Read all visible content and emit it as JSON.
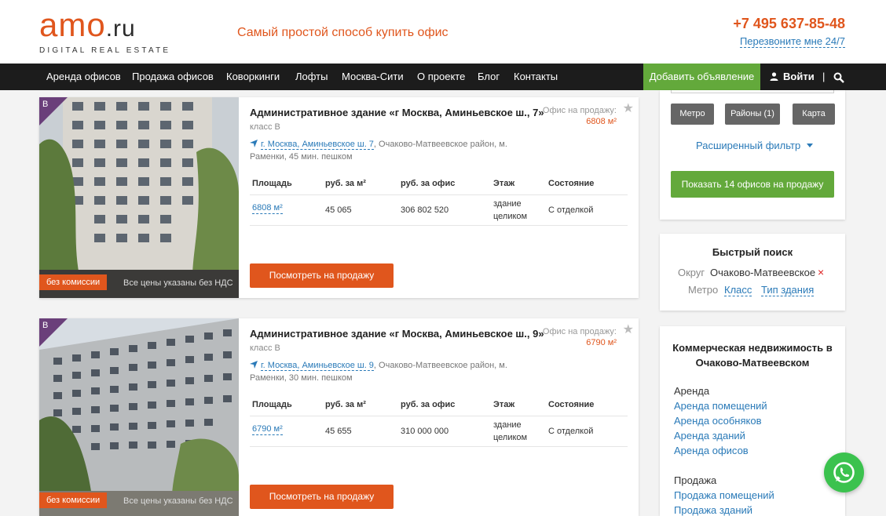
{
  "header": {
    "logo_main": "amo",
    "logo_tld": ".ru",
    "logo_sub": "DIGITAL REAL ESTATE",
    "slogan": "Самый простой способ купить офис",
    "phone": "+7 495 637-85-48",
    "callback": "Перезвоните мне 24/7"
  },
  "nav": {
    "items": [
      "Аренда офисов",
      "Продажа офисов",
      "Коворкинги",
      "Лофты",
      "Москва-Сити",
      "О проекте",
      "Блог",
      "Контакты"
    ],
    "add_listing": "Добавить объявление",
    "login": "Войти",
    "separator": "|"
  },
  "listings": [
    {
      "class_letter": "B",
      "badge": "без комиссии",
      "vat_note": "Все цены указаны без НДС",
      "title": "Административное здание «г Москва, Аминьевское ш., 7»",
      "class_label": "класс B",
      "address_link": "г. Москва, Аминьевское ш. 7",
      "address_rest": ", Очаково-Матвеевское район, м. Раменки, 45 мин. пешком",
      "sale_label": "Офис на продажу:",
      "sale_value": "6808 м²",
      "headers": [
        "Площадь",
        "руб. за м²",
        "руб. за офис",
        "Этаж",
        "Состояние"
      ],
      "row": [
        "6808 м²",
        "45 065",
        "306 802 520",
        "здание целиком",
        "С отделкой"
      ],
      "button": "Посмотреть на продажу"
    },
    {
      "class_letter": "B",
      "badge": "без комиссии",
      "vat_note": "Все цены указаны без НДС",
      "title": "Административное здание «г Москва, Аминьевское ш., 9»",
      "class_label": "класс B",
      "address_link": "г. Москва, Аминьевское ш. 9",
      "address_rest": ", Очаково-Матвеевское район, м. Раменки, 30 мин. пешком",
      "sale_label": "Офис на продажу:",
      "sale_value": "6790 м²",
      "headers": [
        "Площадь",
        "руб. за м²",
        "руб. за офис",
        "Этаж",
        "Состояние"
      ],
      "row": [
        "6790 м²",
        "45 655",
        "310 000 000",
        "здание целиком",
        "С отделкой"
      ],
      "button": "Посмотреть на продажу"
    }
  ],
  "filter": {
    "buttons": [
      "Метро",
      "Районы (1)",
      "Карта"
    ],
    "extended": "Расширенный фильтр",
    "show_button": "Показать 14 офисов на продажу"
  },
  "quick_search": {
    "title": "Быстрый поиск",
    "district_label": "Округ",
    "district_value": "Очаково-Матвеевское",
    "remove": "×",
    "metro_label": "Метро",
    "class_link": "Класс",
    "building_type_link": "Тип здания"
  },
  "commercial": {
    "title": "Коммерческая недвижимость в Очаково-Матвеевском",
    "rent_heading": "Аренда",
    "rent_links": [
      "Аренда помещений",
      "Аренда особняков",
      "Аренда зданий",
      "Аренда офисов"
    ],
    "sale_heading": "Продажа",
    "sale_links": [
      "Продажа помещений",
      "Продажа зданий"
    ]
  },
  "colors": {
    "brand_orange": "#e0561d",
    "nav_dark": "#1c1c1c",
    "green": "#63a93b",
    "link_blue": "#2a7ab8",
    "class_purple": "#6a3f7a",
    "whatsapp": "#3bc24e"
  }
}
